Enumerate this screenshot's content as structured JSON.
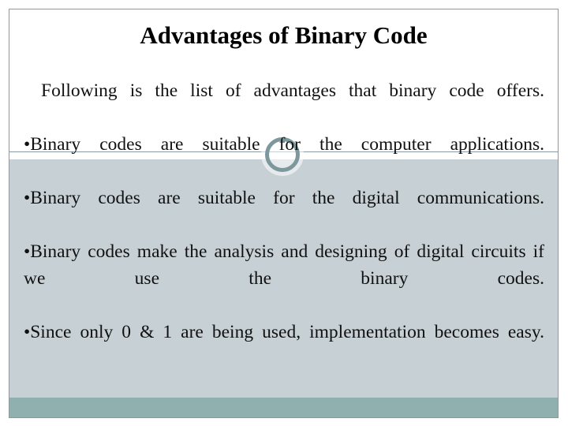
{
  "slide": {
    "title": "Advantages of Binary Code",
    "intro": " Following is the list of advantages that binary code offers.",
    "bullets": [
      "•Binary codes are suitable for the computer applications.",
      "•Binary codes are suitable for the digital communications.",
      "•Binary codes make the analysis and designing of digital circuits if we use the binary codes.",
      "•Since only 0 & 1 are being used, implementation becomes easy."
    ],
    "bullet_char": "•"
  },
  "decor": {
    "ring_name": "circle-ring-decoration",
    "rule_name": "horizontal-divider-rule"
  },
  "colors": {
    "band_white": "#ffffff",
    "band_grey": "#c7d0d4",
    "band_teal": "#90b0b0",
    "frame_line": "#8a9aa0",
    "ring": "#7c989c",
    "text": "#111111",
    "title": "#000000"
  }
}
